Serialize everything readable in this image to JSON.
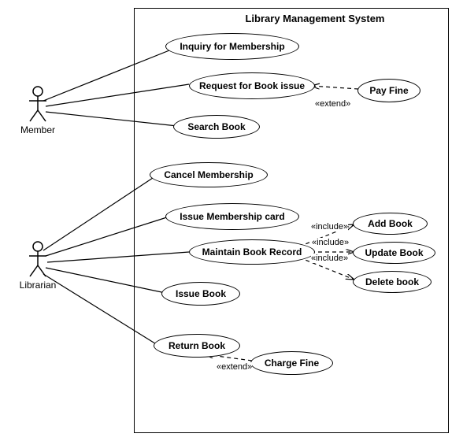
{
  "system": {
    "title": "Library Management System"
  },
  "actors": {
    "member": "Member",
    "librarian": "Librarian"
  },
  "usecases": {
    "inquiry": "Inquiry for Membership",
    "requestBookIssue": "Request for Book issue",
    "payFine": "Pay Fine",
    "searchBook": "Search Book",
    "cancelMembership": "Cancel Membership",
    "issueMembershipCard": "Issue Membership card",
    "maintainBookRecord": "Maintain Book Record",
    "addBook": "Add Book",
    "updateBook": "Update Book",
    "deleteBook": "Delete book",
    "issueBook": "Issue Book",
    "returnBook": "Return Book",
    "chargeFine": "Charge Fine"
  },
  "stereotypes": {
    "extend1": "«extend»",
    "include1": "«include»",
    "include2": "«include»",
    "include3": "«include»",
    "extend2": "«extend»"
  },
  "chart_data": {
    "type": "uml-use-case",
    "title": "Library Management System",
    "actors": [
      "Member",
      "Librarian"
    ],
    "system": "Library Management System",
    "usecases": [
      "Inquiry for Membership",
      "Request for Book issue",
      "Pay Fine",
      "Search Book",
      "Cancel Membership",
      "Issue Membership card",
      "Maintain Book Record",
      "Add Book",
      "Update Book",
      "Delete book",
      "Issue Book",
      "Return Book",
      "Charge Fine"
    ],
    "associations": [
      {
        "actor": "Member",
        "usecase": "Inquiry for Membership"
      },
      {
        "actor": "Member",
        "usecase": "Request for Book issue"
      },
      {
        "actor": "Member",
        "usecase": "Search Book"
      },
      {
        "actor": "Librarian",
        "usecase": "Cancel Membership"
      },
      {
        "actor": "Librarian",
        "usecase": "Issue Membership card"
      },
      {
        "actor": "Librarian",
        "usecase": "Maintain Book Record"
      },
      {
        "actor": "Librarian",
        "usecase": "Issue Book"
      },
      {
        "actor": "Librarian",
        "usecase": "Return Book"
      }
    ],
    "relationships": [
      {
        "from": "Pay Fine",
        "to": "Request for Book issue",
        "type": "extend"
      },
      {
        "from": "Maintain Book Record",
        "to": "Add Book",
        "type": "include"
      },
      {
        "from": "Maintain Book Record",
        "to": "Update Book",
        "type": "include"
      },
      {
        "from": "Maintain Book Record",
        "to": "Delete book",
        "type": "include"
      },
      {
        "from": "Charge Fine",
        "to": "Return Book",
        "type": "extend"
      }
    ]
  }
}
